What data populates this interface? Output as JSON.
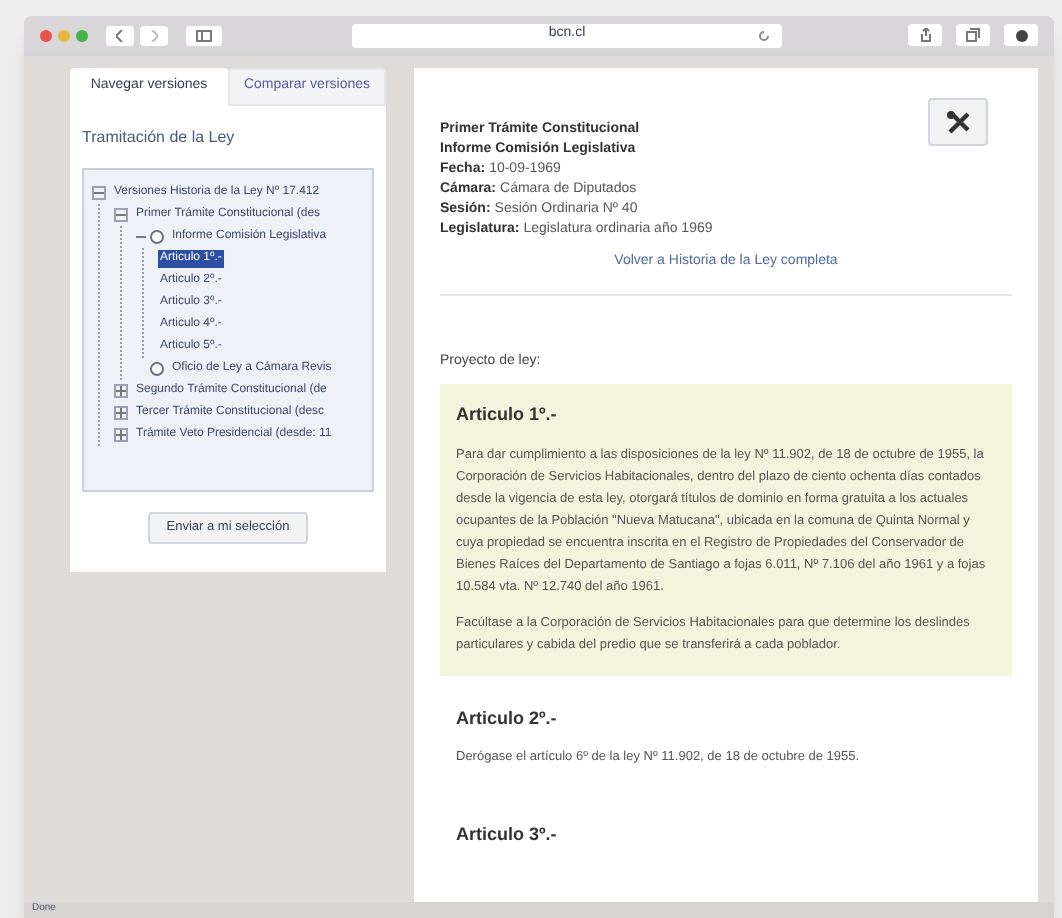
{
  "browser": {
    "address": "bcn.cl"
  },
  "tabs": [
    {
      "label": "Navegar versiones",
      "selected": true
    },
    {
      "label": "Comparar versiones",
      "selected": false
    }
  ],
  "sidebar": {
    "heading": "Tramitación de la Ley",
    "tree": [
      {
        "label": "Versiones Historia de la Ley Nº 17.412",
        "kind": "folder",
        "expanded": true,
        "selected": false,
        "children": [
          {
            "label": "Primer Trámite Constitucional (des",
            "kind": "folder",
            "expanded": true,
            "selected": false,
            "children": [
              {
                "label": "Informe Comisión Legislativa",
                "kind": "radio",
                "expanded": true,
                "selected": false,
                "children": [
                  {
                    "label": "Articulo 1º.-",
                    "selected": true
                  },
                  {
                    "label": "Articulo 2º.-",
                    "selected": false
                  },
                  {
                    "label": "Articulo 3º.-",
                    "selected": false
                  },
                  {
                    "label": "Articulo 4º.-",
                    "selected": false
                  },
                  {
                    "label": "Articulo 5º.-",
                    "selected": false
                  }
                ]
              },
              {
                "label": "Oficio de Ley a Cámara Revis",
                "kind": "radio",
                "expanded": false,
                "selected": false
              }
            ]
          },
          {
            "label": "Segundo Trámite Constitucional (de",
            "kind": "folder",
            "expanded": false,
            "selected": false
          },
          {
            "label": "Tercer Trámite Constitucional (desc",
            "kind": "folder",
            "expanded": false,
            "selected": false
          },
          {
            "label": "Trámite Veto Presidencial (desde: 11",
            "kind": "folder",
            "expanded": false,
            "selected": false
          }
        ]
      }
    ],
    "send_button": "Enviar a mi selección"
  },
  "document": {
    "title_lines": [
      "Primer Trámite Constitucional",
      "Informe Comisión Legislativa"
    ],
    "fields": [
      {
        "label": "Fecha:",
        "value": "10-09-1969"
      },
      {
        "label": "Cámara:",
        "value": "Cámara de Diputados"
      },
      {
        "label": "Sesión:",
        "value": "Sesión Ordinaria Nº 40"
      },
      {
        "label": "Legislatura:",
        "value": "Legislatura ordinaria año 1969"
      }
    ],
    "back_link": "Volver a Historia de la Ley completa",
    "intro": "Proyecto de ley:",
    "articles": [
      {
        "title": "Articulo 1º.-",
        "highlighted": true,
        "paragraphs": [
          "Para dar cumplimiento a las disposiciones de la ley Nº 11.902, de 18 de octubre de 1955, la Corporación de Servicios Habitacionales, dentro del plazo de ciento ochenta días contados desde la vigencia de esta ley, otorgará títulos de dominio en forma gratuita a los actuales ocupantes de la Población \"Nueva Matucana\", ubicada en la comuna de Quinta Normal y cuya propiedad se encuentra inscrita en el Registro de Propiedades del Conservador de Bienes Raíces del Departamento de Santiago a fojas 6.011, Nº 7.106 del año 1961 y a fojas 10.584 vta. Nº 12.740 del año 1961.",
          "Facúltase a la Corporación de Servicios Habitacionales para que determine los deslindes particulares y cabida del predio que se transferirá a cada poblador."
        ]
      },
      {
        "title": "Articulo 2º.-",
        "highlighted": false,
        "paragraphs": [
          "Derógase el artículo 6º de la ley Nº 11.902, de 18 de octubre de 1955."
        ]
      },
      {
        "title": "Articulo 3º.-",
        "highlighted": false
      }
    ]
  },
  "status_bar": "Done"
}
